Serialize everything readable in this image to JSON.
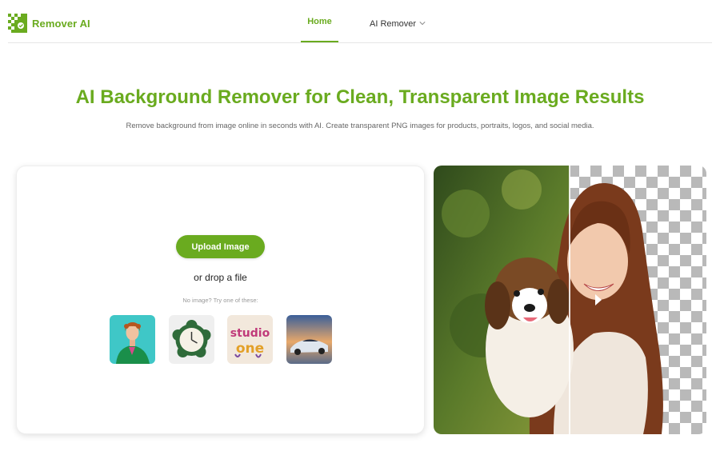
{
  "header": {
    "brand": "Remover AI",
    "nav": {
      "home": "Home",
      "ai_remover": "AI Remover"
    }
  },
  "hero": {
    "title": "AI Background Remover for Clean, Transparent Image Results",
    "subtitle": "Remove background from image online in seconds with AI. Create transparent PNG images for products, portraits, logos, and social media."
  },
  "upload": {
    "button_label": "Upload Image",
    "drop_text": "or drop a file",
    "samples_hint": "No image? Try one of these:",
    "samples": [
      {
        "name": "person-sample"
      },
      {
        "name": "clock-sample"
      },
      {
        "name": "studio-one-sample",
        "text": "studio one"
      },
      {
        "name": "car-sample"
      }
    ]
  },
  "colors": {
    "brand_green": "#6aab1f",
    "divider": "#e6e6e6"
  },
  "icons": {
    "logo": "checker-logo-icon",
    "dropdown": "chevron-down-icon",
    "compare_left": "arrow-left-icon",
    "compare_right": "arrow-right-icon"
  }
}
